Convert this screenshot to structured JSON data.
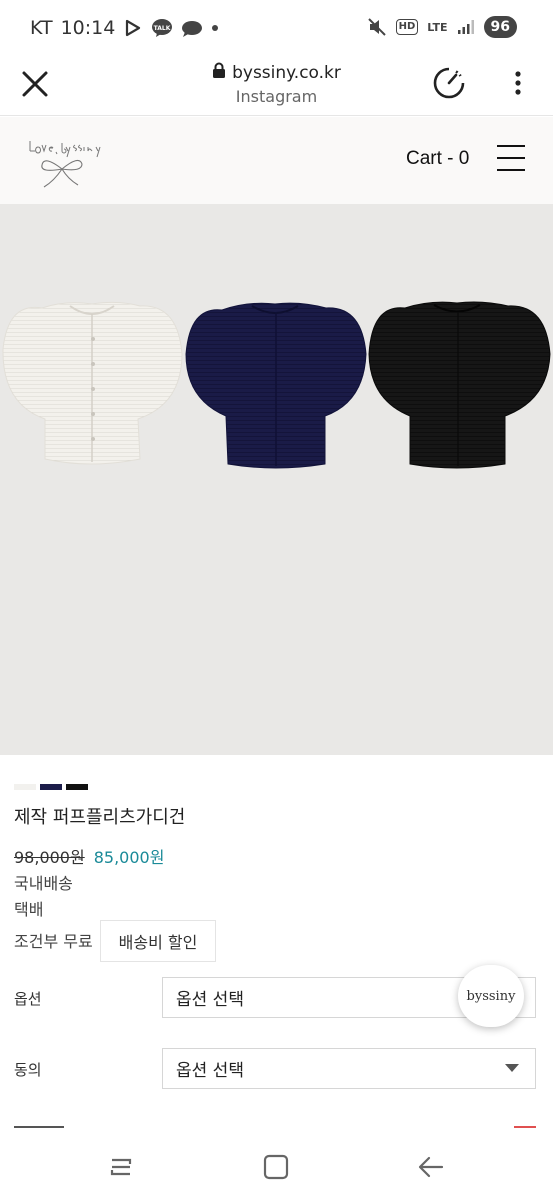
{
  "status_bar": {
    "carrier": "KT",
    "time": "10:14",
    "hd_label": "HD",
    "lte_label": "LTE",
    "battery": "96",
    "icons": [
      "play-icon",
      "talk-icon",
      "cloud-chat-icon",
      "dot-icon",
      "mute-icon",
      "hd-icon",
      "lte-icon",
      "signal-icon",
      "battery-icon"
    ]
  },
  "browser": {
    "url": "byssiny.co.kr",
    "subtitle": "Instagram"
  },
  "site_header": {
    "cart_label": "Cart - 0"
  },
  "product": {
    "swatch_colors": [
      "#f2f1ee",
      "#1c1d4a",
      "#111111"
    ],
    "title": "제작 퍼프플리츠가디건",
    "price_original": "98,000원",
    "price_sale": "85,000원",
    "shipping_domestic": "국내배송",
    "shipping_method": "택배",
    "shipping_condition": "조건부 무료",
    "shipping_discount_button": "배송비 할인"
  },
  "options": [
    {
      "label": "옵션",
      "value": "옵션 선택"
    },
    {
      "label": "동의",
      "value": "옵션 선택"
    }
  ],
  "fab": {
    "label": "byssiny"
  },
  "colors": {
    "accent": "#1a8a98"
  }
}
